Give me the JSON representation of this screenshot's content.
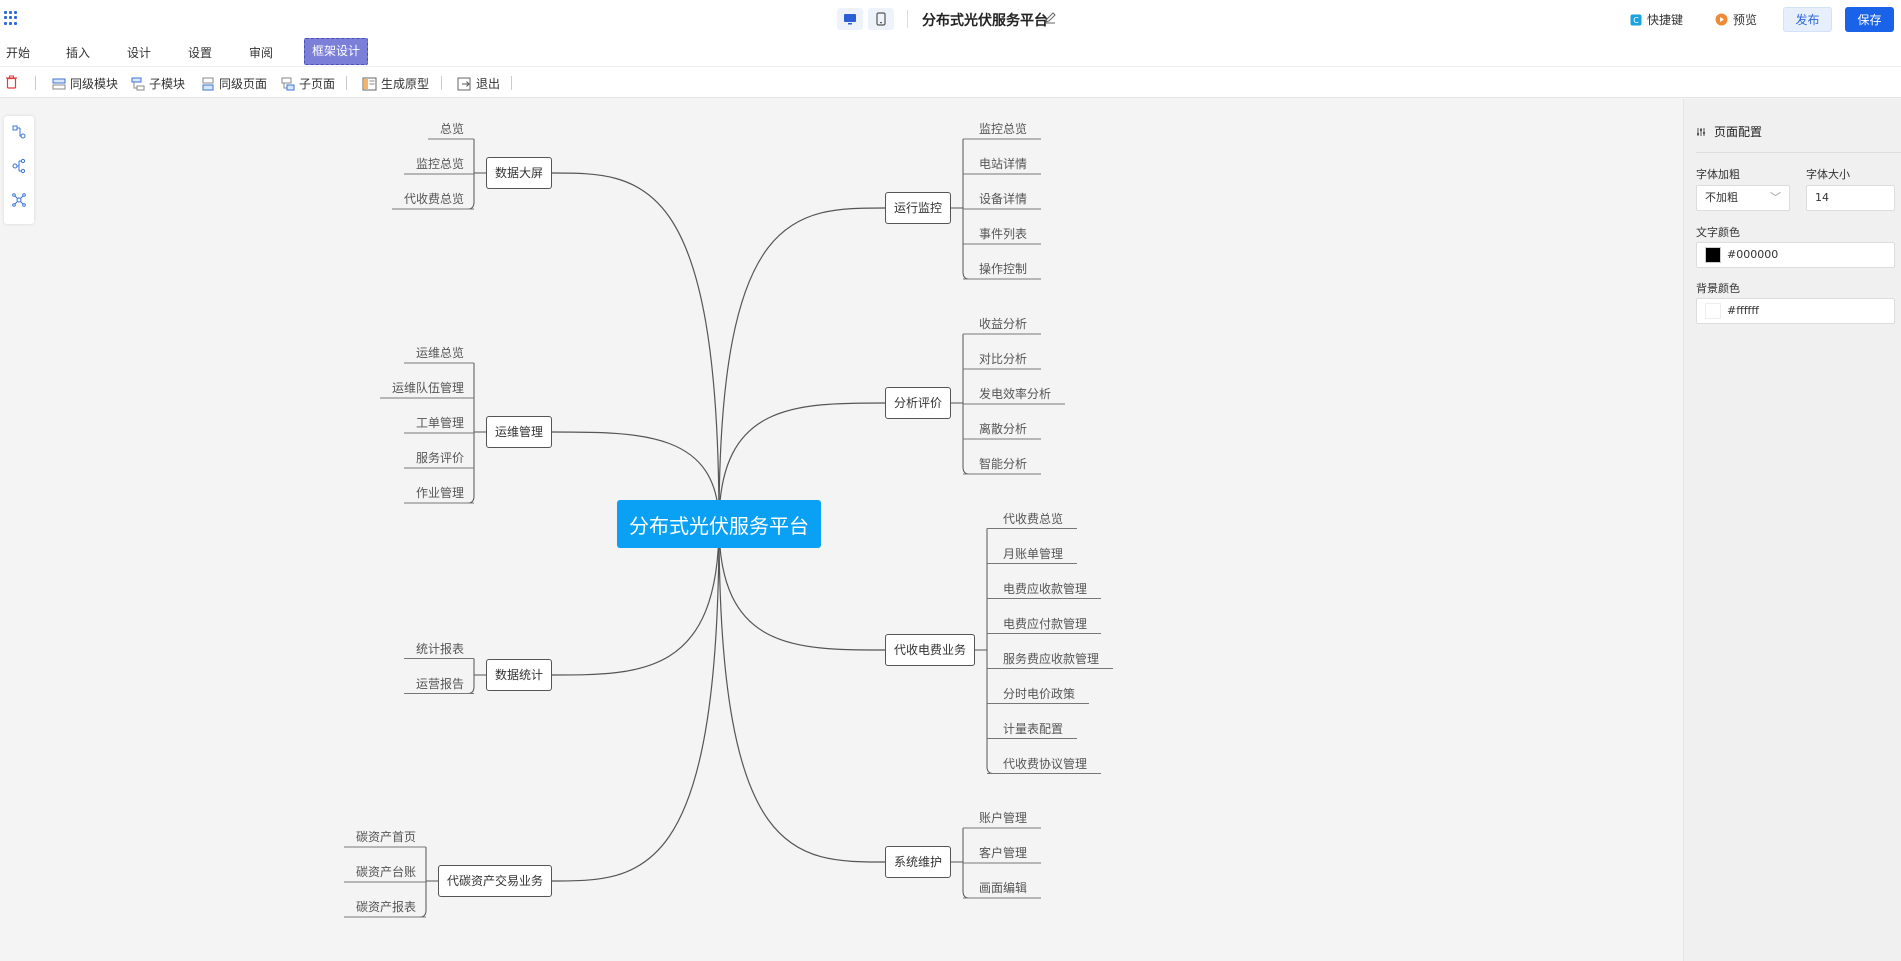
{
  "app": {
    "title": "分布式光伏服务平台",
    "shortcut_label": "快捷键",
    "preview_label": "预览",
    "publish_label": "发布",
    "save_label": "保存"
  },
  "menu": [
    "开始",
    "插入",
    "设计",
    "设置",
    "审阅",
    "框架设计"
  ],
  "toolbar": [
    "同级模块",
    "子模块",
    "同级页面",
    "子页面",
    "生成原型",
    "退出"
  ],
  "mindmap": {
    "root": "分布式光伏服务平台",
    "branches": [
      {
        "label": "数据大屏",
        "children": [
          "总览",
          "监控总览",
          "代收费总览"
        ]
      },
      {
        "label": "运维管理",
        "children": [
          "运维总览",
          "运维队伍管理",
          "工单管理",
          "服务评价",
          "作业管理"
        ]
      },
      {
        "label": "数据统计",
        "children": [
          "统计报表",
          "运营报告"
        ]
      },
      {
        "label": "代碳资产交易业务",
        "children": [
          "碳资产首页",
          "碳资产台账",
          "碳资产报表"
        ]
      },
      {
        "label": "运行监控",
        "children": [
          "监控总览",
          "电站详情",
          "设备详情",
          "事件列表",
          "操作控制"
        ]
      },
      {
        "label": "分析评价",
        "children": [
          "收益分析",
          "对比分析",
          "发电效率分析",
          "离散分析",
          "智能分析"
        ]
      },
      {
        "label": "代收电费业务",
        "children": [
          "代收费总览",
          "月账单管理",
          "电费应收款管理",
          "电费应付款管理",
          "服务费应收款管理",
          "分时电价政策",
          "计量表配置",
          "代收费协议管理"
        ]
      },
      {
        "label": "系统维护",
        "children": [
          "账户管理",
          "客户管理",
          "画面编辑"
        ]
      }
    ]
  },
  "panel": {
    "title": "页面配置",
    "font_weight_label": "字体加粗",
    "font_weight_value": "不加粗",
    "font_size_label": "字体大小",
    "font_size_value": "14",
    "text_color_label": "文字颜色",
    "text_color_value": "#000000",
    "bg_color_label": "背景颜色",
    "bg_color_value": "#ffffff"
  },
  "colors": {
    "accent": "#1a62e8",
    "root_node": "#0aa1f5",
    "active_tab": "#7b7fd8"
  }
}
